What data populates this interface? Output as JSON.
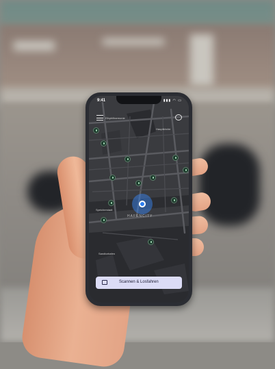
{
  "status_bar": {
    "time": "9:41",
    "indicators": "▮▮▮ ◠ ▭"
  },
  "map": {
    "labels": {
      "top_left": "Elbphilharmonie",
      "top_right": "Hauptkirche",
      "speicherstadt": "Speicherstadt",
      "hafencity": "HAFENCITY",
      "waterfront": "Sandtorhafen"
    }
  },
  "icons": {
    "menu": "hamburger-menu-icon",
    "chat": "chat-bubble-icon",
    "scan": "scan-icon",
    "pin": "scooter-pin-icon",
    "location": "user-location-dot"
  },
  "actions": {
    "scan_button_label": "Scannen & Losfahren"
  },
  "colors": {
    "map_bg": "#3a3b3f",
    "road": "#5a5b60",
    "water": "#26272b",
    "pin": "#1d3b2d",
    "location": "#2f7ff0",
    "button_bg": "#dcdcf6"
  }
}
